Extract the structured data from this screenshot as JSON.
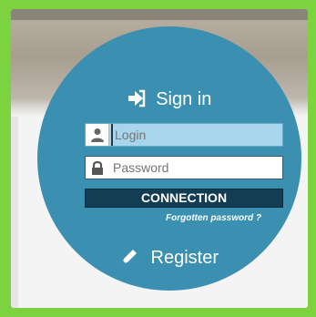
{
  "signin": {
    "title": "Sign in",
    "icon": "sign-in-icon"
  },
  "login_field": {
    "placeholder": "Login",
    "icon": "user-icon"
  },
  "password_field": {
    "placeholder": "Password",
    "icon": "lock-icon"
  },
  "connect_button": {
    "label": "CONNECTION"
  },
  "forgot_link": {
    "label": "Forgotten password ?"
  },
  "register": {
    "label": "Register",
    "icon": "pencil-icon"
  },
  "colors": {
    "outer_background": "#7dd33f",
    "circle": "#3b8fb1",
    "button": "#123d52",
    "login_highlight": "#a6d5ec"
  }
}
